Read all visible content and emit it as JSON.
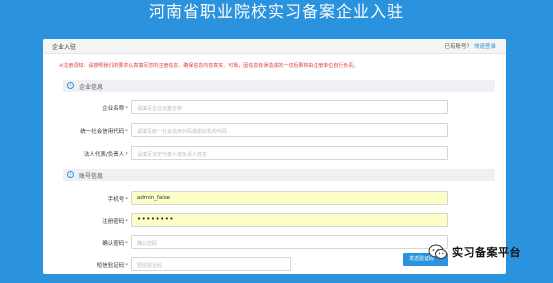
{
  "page": {
    "title": "河南省职业院校实习备案企业入驻"
  },
  "header": {
    "title": "企业入驻",
    "account_prompt": "已有账号？",
    "login_link": "快速登录"
  },
  "notice": "※注册须知：请按照我们的要求认真填写您的注册信息，确保信息内容真实、可靠，因信息有误造成的一切后果将由注册单位自行负责。",
  "sections": {
    "company": {
      "title": "企业信息",
      "icon": "info-circle-icon"
    },
    "account": {
      "title": "账号信息",
      "icon": "info-circle-icon"
    }
  },
  "company_form": {
    "name": {
      "label": "企业名称",
      "required": "*",
      "placeholder": "请填写企业完整全称"
    },
    "credit_code": {
      "label": "统一社会信用代码",
      "required": "*",
      "placeholder": "请填写统一社会信用代码或组织机构代码"
    },
    "legal_rep": {
      "label": "法人代表/负责人",
      "required": "*",
      "placeholder": "请填写法定代表人或负责人姓名"
    }
  },
  "account_form": {
    "phone": {
      "label": "手机号",
      "required": "*",
      "value": "admin_false"
    },
    "password": {
      "label": "注册密码",
      "required": "*",
      "value": "••••••••"
    },
    "confirm": {
      "label": "确认密码",
      "required": "*",
      "placeholder": "确认密码"
    },
    "sms_code": {
      "label": "短信验证码",
      "required": "*",
      "placeholder": "短信验证码",
      "button": "发送验证码"
    }
  },
  "watermark": {
    "text": "实习备案平台",
    "icon": "wechat-icon"
  },
  "colors": {
    "background": "#2b93de",
    "accent": "#2b93de",
    "required": "#e03c3c",
    "autofill": "#fdfdc8"
  }
}
